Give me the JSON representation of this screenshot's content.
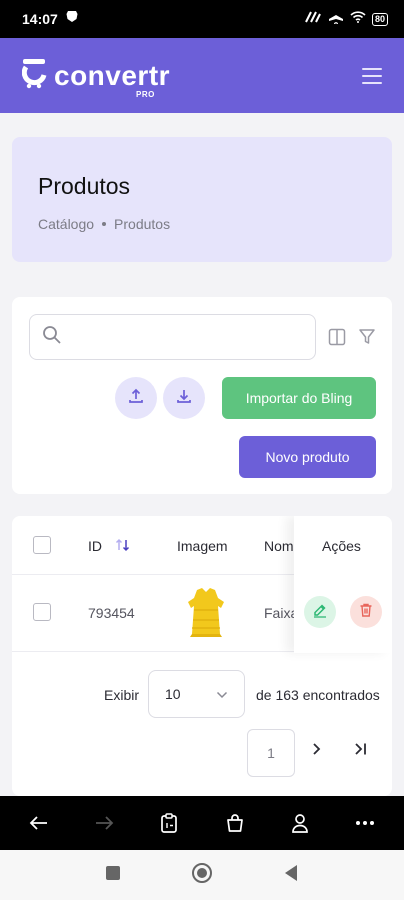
{
  "status_bar": {
    "time": "14:07",
    "battery": "80"
  },
  "app": {
    "logo_text": "convertr",
    "logo_badge": "PRO"
  },
  "page": {
    "title": "Produtos",
    "breadcrumb": [
      "Catálogo",
      "Produtos"
    ]
  },
  "toolbar": {
    "search_placeholder": "",
    "import_label": "Importar do Bling",
    "new_label": "Novo produto"
  },
  "table": {
    "columns": [
      "ID",
      "Imagem",
      "Nom",
      "Ações"
    ],
    "rows": [
      {
        "id": "793454",
        "name": "Faixa"
      }
    ]
  },
  "pagination": {
    "show_label": "Exibir",
    "per_page": "10",
    "found_label": "de 163 encontrados",
    "current_page": "1"
  },
  "colors": {
    "brand": "#6c5fd8",
    "success": "#5ec47f",
    "danger": "#e8645a"
  }
}
